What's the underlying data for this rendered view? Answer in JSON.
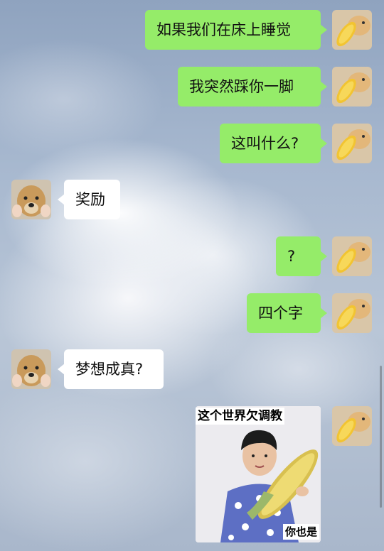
{
  "chat": {
    "messages": [
      {
        "from": "me",
        "text": "如果我们在床上睡觉",
        "avatar": "cat-with-corn-avatar"
      },
      {
        "from": "me",
        "text": "我突然踩你一脚",
        "avatar": "cat-with-corn-avatar"
      },
      {
        "from": "me",
        "text": "这叫什么?",
        "avatar": "cat-with-corn-avatar"
      },
      {
        "from": "other",
        "text": "奖励",
        "avatar": "puppy-avatar"
      },
      {
        "from": "me",
        "text": "?",
        "avatar": "cat-with-corn-avatar"
      },
      {
        "from": "me",
        "text": "四个字",
        "avatar": "cat-with-corn-avatar"
      },
      {
        "from": "other",
        "text": "梦想成真?",
        "avatar": "puppy-avatar"
      }
    ],
    "sticker": {
      "top_caption": "这个世界欠调教",
      "bottom_caption": "你也是",
      "from": "me"
    }
  },
  "colors": {
    "my_bubble": "#95ec69",
    "other_bubble": "#ffffff"
  }
}
